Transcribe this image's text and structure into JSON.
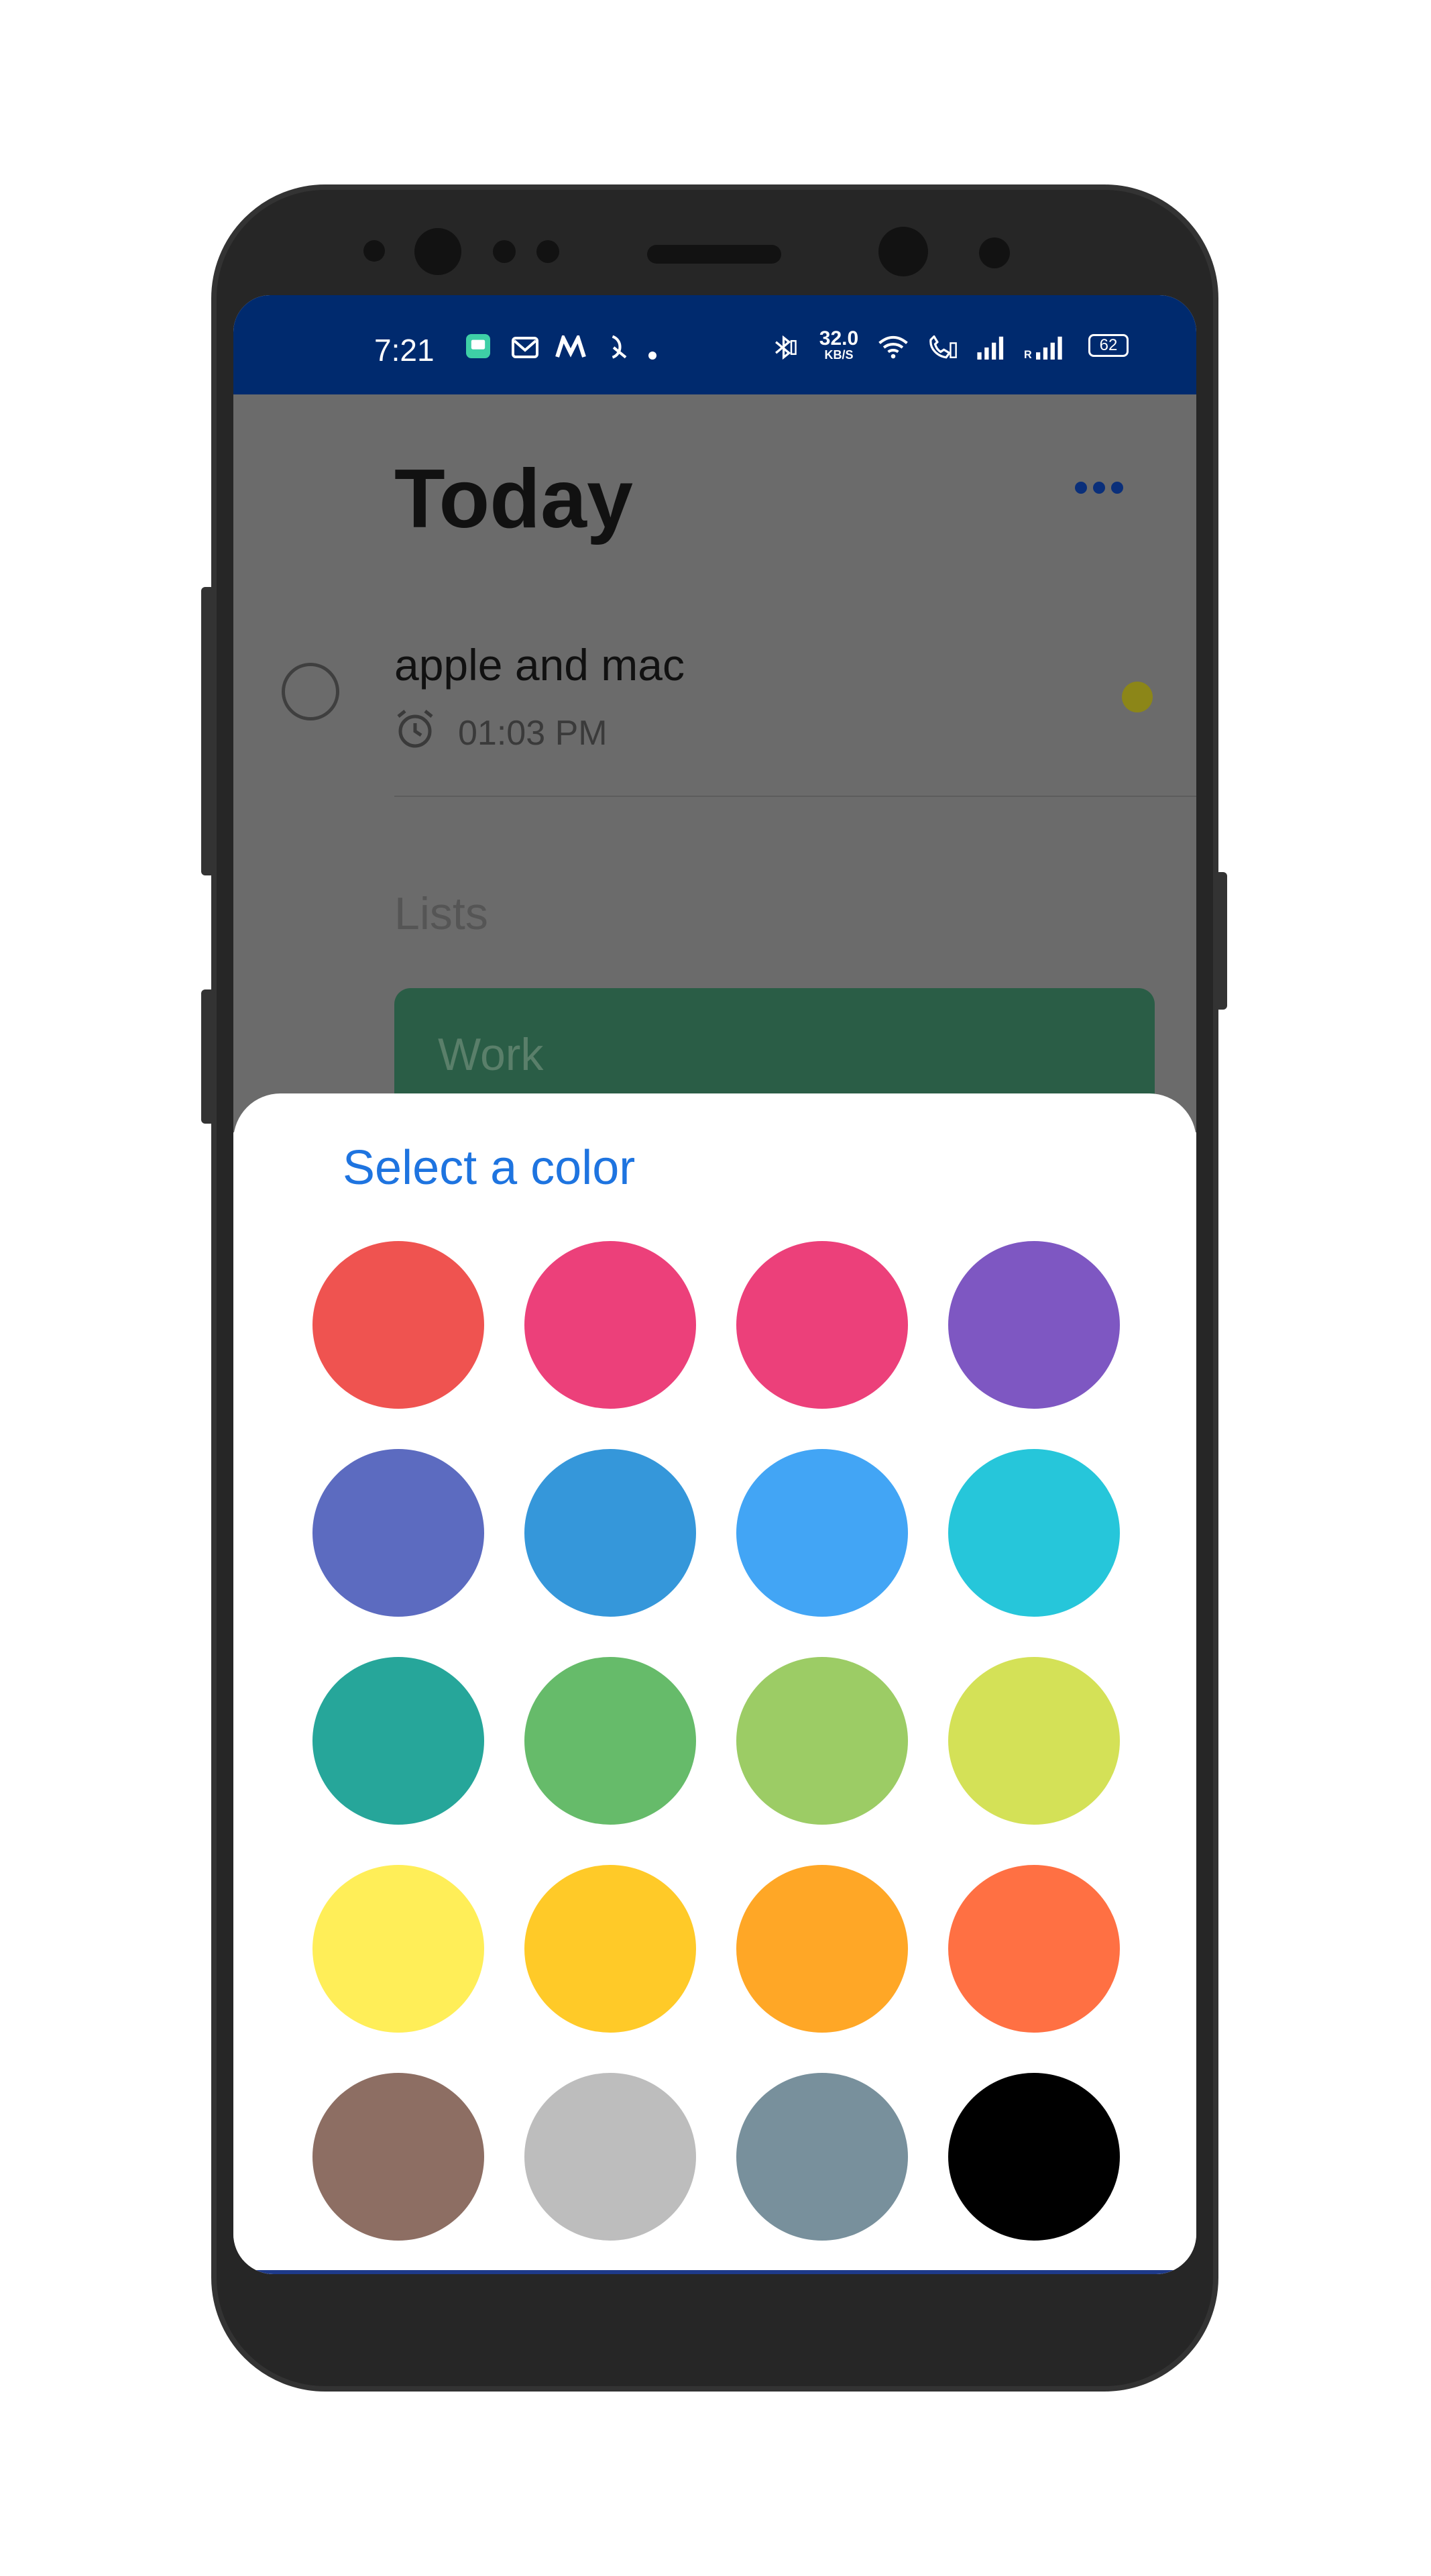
{
  "status_bar": {
    "time": "7:21",
    "network_speed": "32.0",
    "network_unit": "KB/S",
    "battery": "62"
  },
  "app": {
    "title": "Today",
    "more_icon": "more-horizontal-icon",
    "task": {
      "title": "apple and mac",
      "time": "01:03 PM",
      "dot_color": "#8c8618"
    },
    "lists_label": "Lists",
    "list_card": {
      "name": "Work",
      "color": "#2a5d46"
    }
  },
  "sheet": {
    "title": "Select a color",
    "colors": [
      "#ef5350",
      "#ec407a",
      "#ec407a",
      "#7e57c2",
      "#5c6bc0",
      "#3597da",
      "#42a5f5",
      "#26c6da",
      "#26a69a",
      "#66bb6a",
      "#9ccc65",
      "#d4e157",
      "#ffee58",
      "#ffca28",
      "#ffa726",
      "#ff7043",
      "#8d6e63",
      "#bdbdbd",
      "#78909c",
      "#000000"
    ]
  }
}
